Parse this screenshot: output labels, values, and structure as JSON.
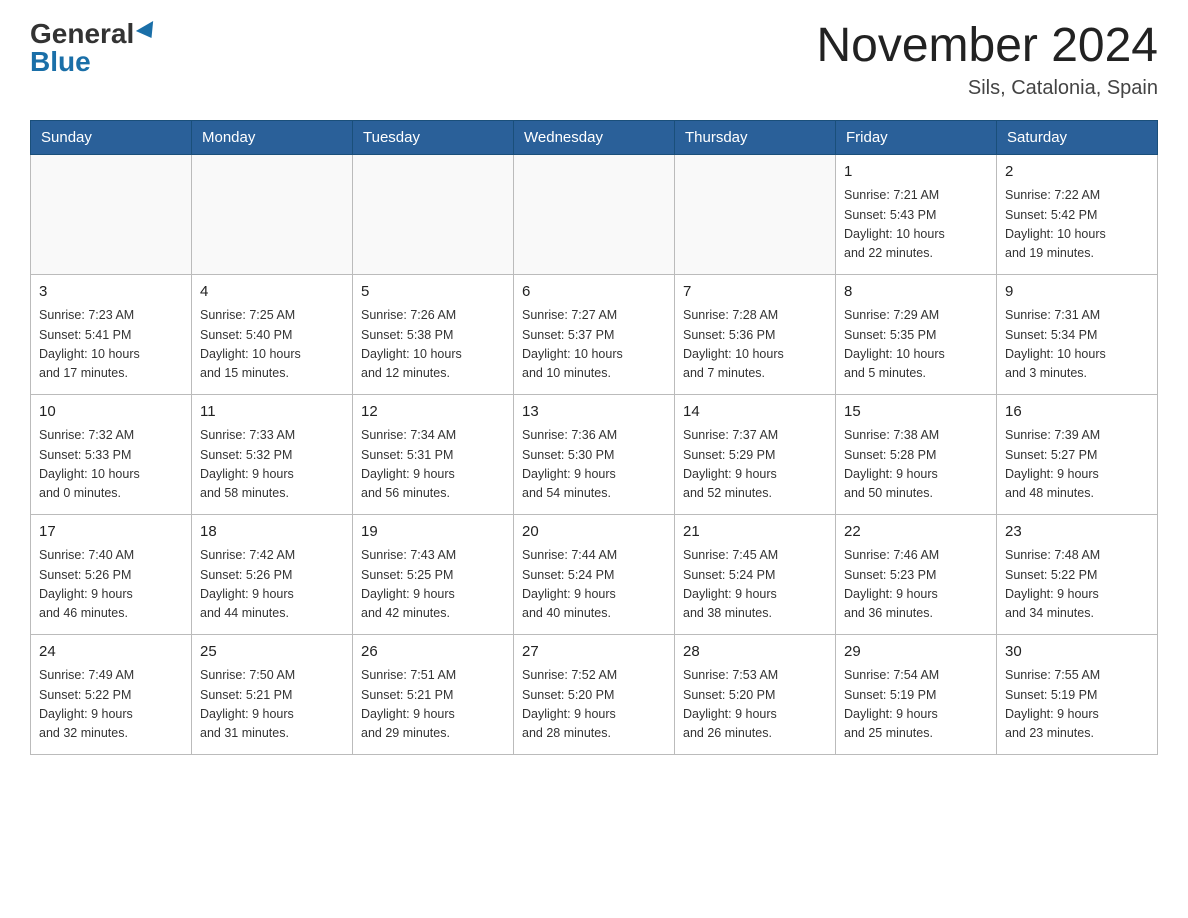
{
  "header": {
    "logo": {
      "general": "General",
      "blue": "Blue",
      "arrow": "▶"
    },
    "title": "November 2024",
    "location": "Sils, Catalonia, Spain"
  },
  "calendar": {
    "days_of_week": [
      "Sunday",
      "Monday",
      "Tuesday",
      "Wednesday",
      "Thursday",
      "Friday",
      "Saturday"
    ],
    "weeks": [
      [
        {
          "day": "",
          "info": ""
        },
        {
          "day": "",
          "info": ""
        },
        {
          "day": "",
          "info": ""
        },
        {
          "day": "",
          "info": ""
        },
        {
          "day": "",
          "info": ""
        },
        {
          "day": "1",
          "info": "Sunrise: 7:21 AM\nSunset: 5:43 PM\nDaylight: 10 hours\nand 22 minutes."
        },
        {
          "day": "2",
          "info": "Sunrise: 7:22 AM\nSunset: 5:42 PM\nDaylight: 10 hours\nand 19 minutes."
        }
      ],
      [
        {
          "day": "3",
          "info": "Sunrise: 7:23 AM\nSunset: 5:41 PM\nDaylight: 10 hours\nand 17 minutes."
        },
        {
          "day": "4",
          "info": "Sunrise: 7:25 AM\nSunset: 5:40 PM\nDaylight: 10 hours\nand 15 minutes."
        },
        {
          "day": "5",
          "info": "Sunrise: 7:26 AM\nSunset: 5:38 PM\nDaylight: 10 hours\nand 12 minutes."
        },
        {
          "day": "6",
          "info": "Sunrise: 7:27 AM\nSunset: 5:37 PM\nDaylight: 10 hours\nand 10 minutes."
        },
        {
          "day": "7",
          "info": "Sunrise: 7:28 AM\nSunset: 5:36 PM\nDaylight: 10 hours\nand 7 minutes."
        },
        {
          "day": "8",
          "info": "Sunrise: 7:29 AM\nSunset: 5:35 PM\nDaylight: 10 hours\nand 5 minutes."
        },
        {
          "day": "9",
          "info": "Sunrise: 7:31 AM\nSunset: 5:34 PM\nDaylight: 10 hours\nand 3 minutes."
        }
      ],
      [
        {
          "day": "10",
          "info": "Sunrise: 7:32 AM\nSunset: 5:33 PM\nDaylight: 10 hours\nand 0 minutes."
        },
        {
          "day": "11",
          "info": "Sunrise: 7:33 AM\nSunset: 5:32 PM\nDaylight: 9 hours\nand 58 minutes."
        },
        {
          "day": "12",
          "info": "Sunrise: 7:34 AM\nSunset: 5:31 PM\nDaylight: 9 hours\nand 56 minutes."
        },
        {
          "day": "13",
          "info": "Sunrise: 7:36 AM\nSunset: 5:30 PM\nDaylight: 9 hours\nand 54 minutes."
        },
        {
          "day": "14",
          "info": "Sunrise: 7:37 AM\nSunset: 5:29 PM\nDaylight: 9 hours\nand 52 minutes."
        },
        {
          "day": "15",
          "info": "Sunrise: 7:38 AM\nSunset: 5:28 PM\nDaylight: 9 hours\nand 50 minutes."
        },
        {
          "day": "16",
          "info": "Sunrise: 7:39 AM\nSunset: 5:27 PM\nDaylight: 9 hours\nand 48 minutes."
        }
      ],
      [
        {
          "day": "17",
          "info": "Sunrise: 7:40 AM\nSunset: 5:26 PM\nDaylight: 9 hours\nand 46 minutes."
        },
        {
          "day": "18",
          "info": "Sunrise: 7:42 AM\nSunset: 5:26 PM\nDaylight: 9 hours\nand 44 minutes."
        },
        {
          "day": "19",
          "info": "Sunrise: 7:43 AM\nSunset: 5:25 PM\nDaylight: 9 hours\nand 42 minutes."
        },
        {
          "day": "20",
          "info": "Sunrise: 7:44 AM\nSunset: 5:24 PM\nDaylight: 9 hours\nand 40 minutes."
        },
        {
          "day": "21",
          "info": "Sunrise: 7:45 AM\nSunset: 5:24 PM\nDaylight: 9 hours\nand 38 minutes."
        },
        {
          "day": "22",
          "info": "Sunrise: 7:46 AM\nSunset: 5:23 PM\nDaylight: 9 hours\nand 36 minutes."
        },
        {
          "day": "23",
          "info": "Sunrise: 7:48 AM\nSunset: 5:22 PM\nDaylight: 9 hours\nand 34 minutes."
        }
      ],
      [
        {
          "day": "24",
          "info": "Sunrise: 7:49 AM\nSunset: 5:22 PM\nDaylight: 9 hours\nand 32 minutes."
        },
        {
          "day": "25",
          "info": "Sunrise: 7:50 AM\nSunset: 5:21 PM\nDaylight: 9 hours\nand 31 minutes."
        },
        {
          "day": "26",
          "info": "Sunrise: 7:51 AM\nSunset: 5:21 PM\nDaylight: 9 hours\nand 29 minutes."
        },
        {
          "day": "27",
          "info": "Sunrise: 7:52 AM\nSunset: 5:20 PM\nDaylight: 9 hours\nand 28 minutes."
        },
        {
          "day": "28",
          "info": "Sunrise: 7:53 AM\nSunset: 5:20 PM\nDaylight: 9 hours\nand 26 minutes."
        },
        {
          "day": "29",
          "info": "Sunrise: 7:54 AM\nSunset: 5:19 PM\nDaylight: 9 hours\nand 25 minutes."
        },
        {
          "day": "30",
          "info": "Sunrise: 7:55 AM\nSunset: 5:19 PM\nDaylight: 9 hours\nand 23 minutes."
        }
      ]
    ]
  }
}
